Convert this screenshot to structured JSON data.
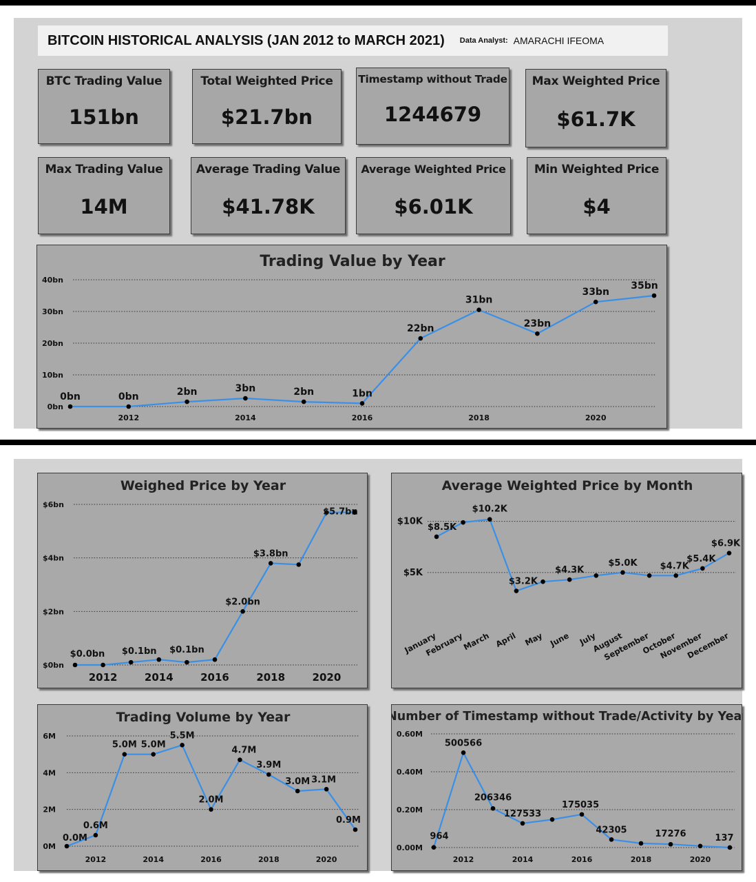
{
  "header": {
    "title": "BITCOIN HISTORICAL ANALYSIS (JAN 2012 to MARCH 2021)",
    "analyst_label": "Data Analyst:",
    "analyst_name": "AMARACHI IFEOMA"
  },
  "kpis": [
    {
      "label": "BTC Trading Value",
      "value": "151bn"
    },
    {
      "label": "Total Weighted Price",
      "value": "$21.7bn"
    },
    {
      "label": "Timestamp without Trade",
      "value": "1244679"
    },
    {
      "label": "Max Weighted Price",
      "value": "$61.7K"
    },
    {
      "label": "Max Trading Value",
      "value": "14M"
    },
    {
      "label": "Average Trading Value",
      "value": "$41.78K"
    },
    {
      "label": "Average Weighted Price",
      "value": "$6.01K"
    },
    {
      "label": "Min Weighted Price",
      "value": "$4"
    }
  ],
  "colors": {
    "line": "#3a8fe6",
    "panel": "#d3d3d3",
    "card": "#a7a7a7",
    "chart_bg": "#a9a9a9"
  },
  "chart_data": [
    {
      "id": "tv",
      "type": "line",
      "title": "Trading Value by Year",
      "x": [
        2011,
        2012,
        2013,
        2014,
        2015,
        2016,
        2017,
        2018,
        2019,
        2020,
        2021
      ],
      "values": [
        0,
        0,
        1.5,
        2.6,
        1.5,
        1,
        21.5,
        30.5,
        23,
        33,
        35
      ],
      "data_labels": [
        "0bn",
        "0bn",
        "2bn",
        "3bn",
        "2bn",
        "1bn",
        "22bn",
        "31bn",
        "23bn",
        "33bn",
        "35bn"
      ],
      "ylim": [
        0,
        40
      ],
      "yticks": [
        0,
        10,
        20,
        30,
        40
      ],
      "ytick_labels": [
        "0bn",
        "10bn",
        "20bn",
        "30bn",
        "40bn"
      ],
      "xticks": [
        2012,
        2014,
        2016,
        2018,
        2020
      ],
      "xtick_labels": [
        "2012",
        "2014",
        "2016",
        "2018",
        "2020"
      ],
      "grid": true
    },
    {
      "id": "wp",
      "type": "line",
      "title": "Weighed Price by Year",
      "x": [
        2011,
        2012,
        2013,
        2014,
        2015,
        2016,
        2017,
        2018,
        2019,
        2020,
        2021
      ],
      "values": [
        0.0,
        0.0,
        0.1,
        0.2,
        0.1,
        0.2,
        2.0,
        3.8,
        3.75,
        5.7,
        5.7
      ],
      "data_labels": [
        "$0.0bn",
        "",
        "$0.1bn",
        "",
        "$0.1bn",
        "",
        "$2.0bn",
        "$3.8bn",
        "",
        "$5.7bn",
        ""
      ],
      "ylim": [
        0,
        6
      ],
      "yticks": [
        0,
        2,
        4,
        6
      ],
      "ytick_labels": [
        "$0bn",
        "$2bn",
        "$4bn",
        "$6bn"
      ],
      "xticks": [
        2012,
        2014,
        2016,
        2018,
        2020
      ],
      "xtick_labels": [
        "2012",
        "2014",
        "2016",
        "2018",
        "2020"
      ],
      "grid": true
    },
    {
      "id": "awm",
      "type": "line",
      "title": "Average Weighted Price by Month",
      "categories": [
        "January",
        "February",
        "March",
        "April",
        "May",
        "June",
        "July",
        "August",
        "September",
        "October",
        "November",
        "December"
      ],
      "values": [
        8.5,
        9.9,
        10.2,
        3.2,
        4.1,
        4.3,
        4.7,
        5.0,
        4.7,
        4.7,
        5.4,
        6.9
      ],
      "data_labels": [
        "$8.5K",
        "",
        "$10.2K",
        "$3.2K",
        "",
        "$4.3K",
        "",
        "$5.0K",
        "",
        "$4.7K",
        "$5.4K",
        "$6.9K"
      ],
      "ylim": [
        0,
        12
      ],
      "yticks": [
        5,
        10
      ],
      "ytick_labels": [
        "$5K",
        "$10K"
      ],
      "grid": true
    },
    {
      "id": "vol",
      "type": "line",
      "title": "Trading Volume by Year",
      "x": [
        2011,
        2012,
        2013,
        2014,
        2015,
        2016,
        2017,
        2018,
        2019,
        2020,
        2021
      ],
      "values": [
        0.0,
        0.6,
        5.0,
        5.0,
        5.5,
        2.0,
        4.7,
        3.9,
        3.0,
        3.1,
        0.9
      ],
      "data_labels": [
        "0.0M",
        "0.6M",
        "5.0M",
        "5.0M",
        "5.5M",
        "2.0M",
        "4.7M",
        "3.9M",
        "3.0M",
        "3.1M",
        "0.9M"
      ],
      "ylim": [
        0,
        6
      ],
      "yticks": [
        0,
        2,
        4,
        6
      ],
      "ytick_labels": [
        "0M",
        "2M",
        "4M",
        "6M"
      ],
      "xticks": [
        2012,
        2014,
        2016,
        2018,
        2020
      ],
      "xtick_labels": [
        "2012",
        "2014",
        "2016",
        "2018",
        "2020"
      ],
      "grid": true
    },
    {
      "id": "ts",
      "type": "line",
      "title": "Number of Timestamp without Trade/Activity by Year",
      "x": [
        2011,
        2012,
        2013,
        2014,
        2015,
        2016,
        2017,
        2018,
        2019,
        2020,
        2021
      ],
      "values": [
        964,
        500566,
        206346,
        127533,
        148000,
        175035,
        42305,
        22000,
        17276,
        8000,
        137
      ],
      "data_labels": [
        "964",
        "500566",
        "206346",
        "127533",
        "",
        "175035",
        "42305",
        "",
        "17276",
        "",
        "137"
      ],
      "ylim": [
        0,
        600000
      ],
      "yticks": [
        0,
        200000,
        400000,
        600000
      ],
      "ytick_labels": [
        "0.00M",
        "0.20M",
        "0.40M",
        "0.60M"
      ],
      "xticks": [
        2012,
        2014,
        2016,
        2018,
        2020
      ],
      "xtick_labels": [
        "2012",
        "2014",
        "2016",
        "2018",
        "2020"
      ],
      "grid": true
    }
  ]
}
